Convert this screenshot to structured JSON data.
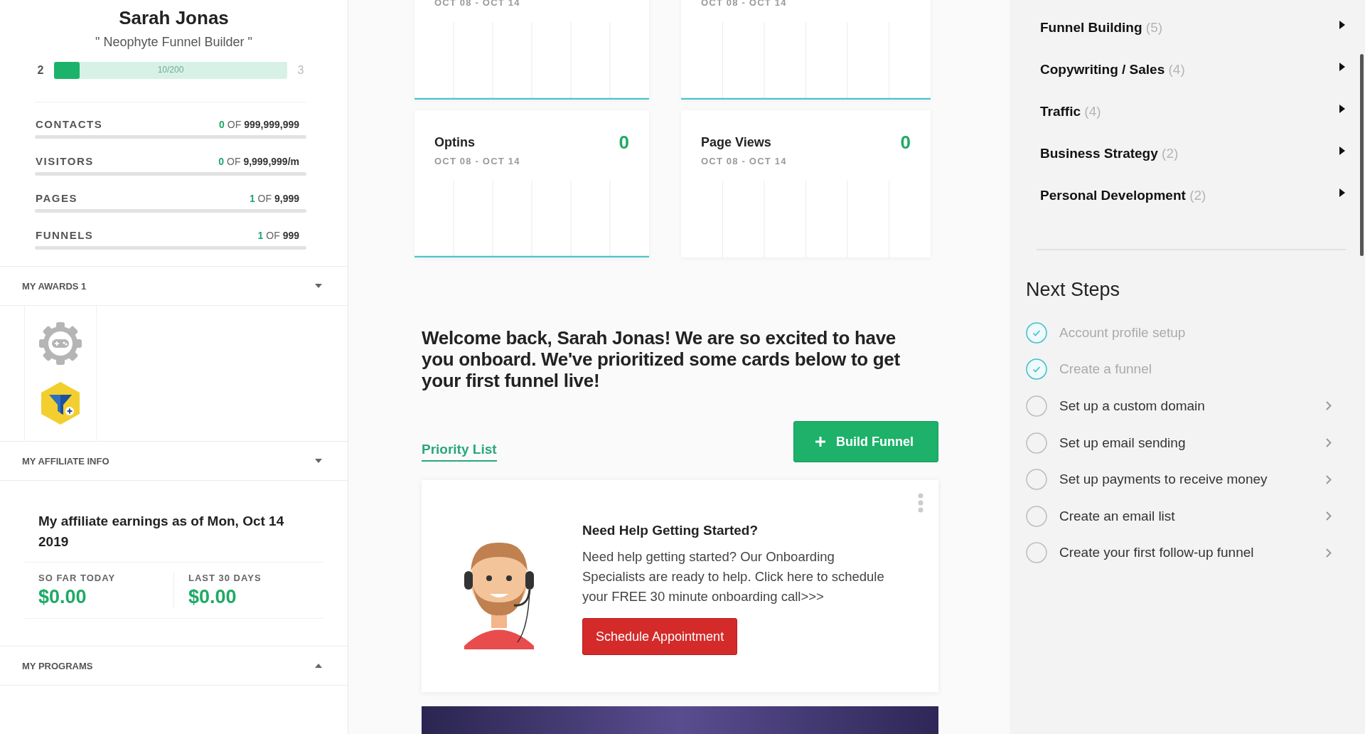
{
  "sidebar": {
    "name": "Sarah Jonas",
    "title": "\" Neophyte Funnel Builder \"",
    "level_bar": {
      "current": "2",
      "next": "3",
      "progress": "10/200",
      "level": 0.11
    },
    "usage": [
      {
        "label": "CONTACTS",
        "used": "0",
        "of": "OF",
        "limit": "999,999,999"
      },
      {
        "label": "VISITORS",
        "used": "0",
        "of": "OF",
        "limit": "9,999,999/m"
      },
      {
        "label": "PAGES",
        "used": "1",
        "of": "OF",
        "limit": "9,999"
      },
      {
        "label": "FUNNELS",
        "used": "1",
        "of": "OF",
        "limit": "999"
      }
    ],
    "sections": [
      {
        "kind": "awards",
        "title": "MY AWARDS 1",
        "expanded": true
      },
      {
        "kind": "affiliate",
        "title": "MY AFFILIATE INFO",
        "expanded": true,
        "heading": "My affiliate earnings as of Mon, Oct 14 2019",
        "stats": [
          {
            "label": "SO FAR TODAY",
            "value": "$0.00"
          },
          {
            "label": "LAST 30 DAYS",
            "value": "$0.00"
          }
        ]
      },
      {
        "kind": "programs",
        "title": "MY PROGRAMS",
        "expanded": false
      }
    ]
  },
  "stat_cards": [
    {
      "date": "OCT 08 - OCT 14",
      "baseline": true
    },
    {
      "date": "OCT 08 - OCT 14",
      "baseline": true
    },
    {
      "title": "Optins",
      "value": "0",
      "date": "OCT 08 - OCT 14",
      "baseline": true
    },
    {
      "title": "Page Views",
      "value": "0",
      "date": "OCT 08 - OCT 14",
      "baseline": false
    }
  ],
  "welcome": "Welcome back, Sarah Jonas! We are so excited to have you onboard. We've prioritized some cards below to get your first funnel live!",
  "priority_tab": {
    "label": "Priority List",
    "selected": true
  },
  "build_button": "Build Funnel",
  "help_card": {
    "title": "Need Help Getting Started?",
    "body": "Need help getting started? Our Onboarding Specialists are ready to help. Click here to schedule your FREE 30 minute onboarding call>>>",
    "button": "Schedule Appointment"
  },
  "categories": [
    {
      "name": "Funnel Building",
      "count": "(5)"
    },
    {
      "name": "Copywriting / Sales",
      "count": "(4)"
    },
    {
      "name": "Traffic",
      "count": "(4)"
    },
    {
      "name": "Business Strategy",
      "count": "(2)"
    },
    {
      "name": "Personal Development",
      "count": "(2)"
    }
  ],
  "next_steps": {
    "title": "Next Steps",
    "items": [
      {
        "label": "Account profile setup",
        "checked": true
      },
      {
        "label": "Create a funnel",
        "checked": true
      },
      {
        "label": "Set up a custom domain",
        "checked": false
      },
      {
        "label": "Set up email sending",
        "checked": false
      },
      {
        "label": "Set up payments to receive money",
        "checked": false
      },
      {
        "label": "Create an email list",
        "checked": false
      },
      {
        "label": "Create your first follow-up funnel",
        "checked": false
      }
    ]
  }
}
